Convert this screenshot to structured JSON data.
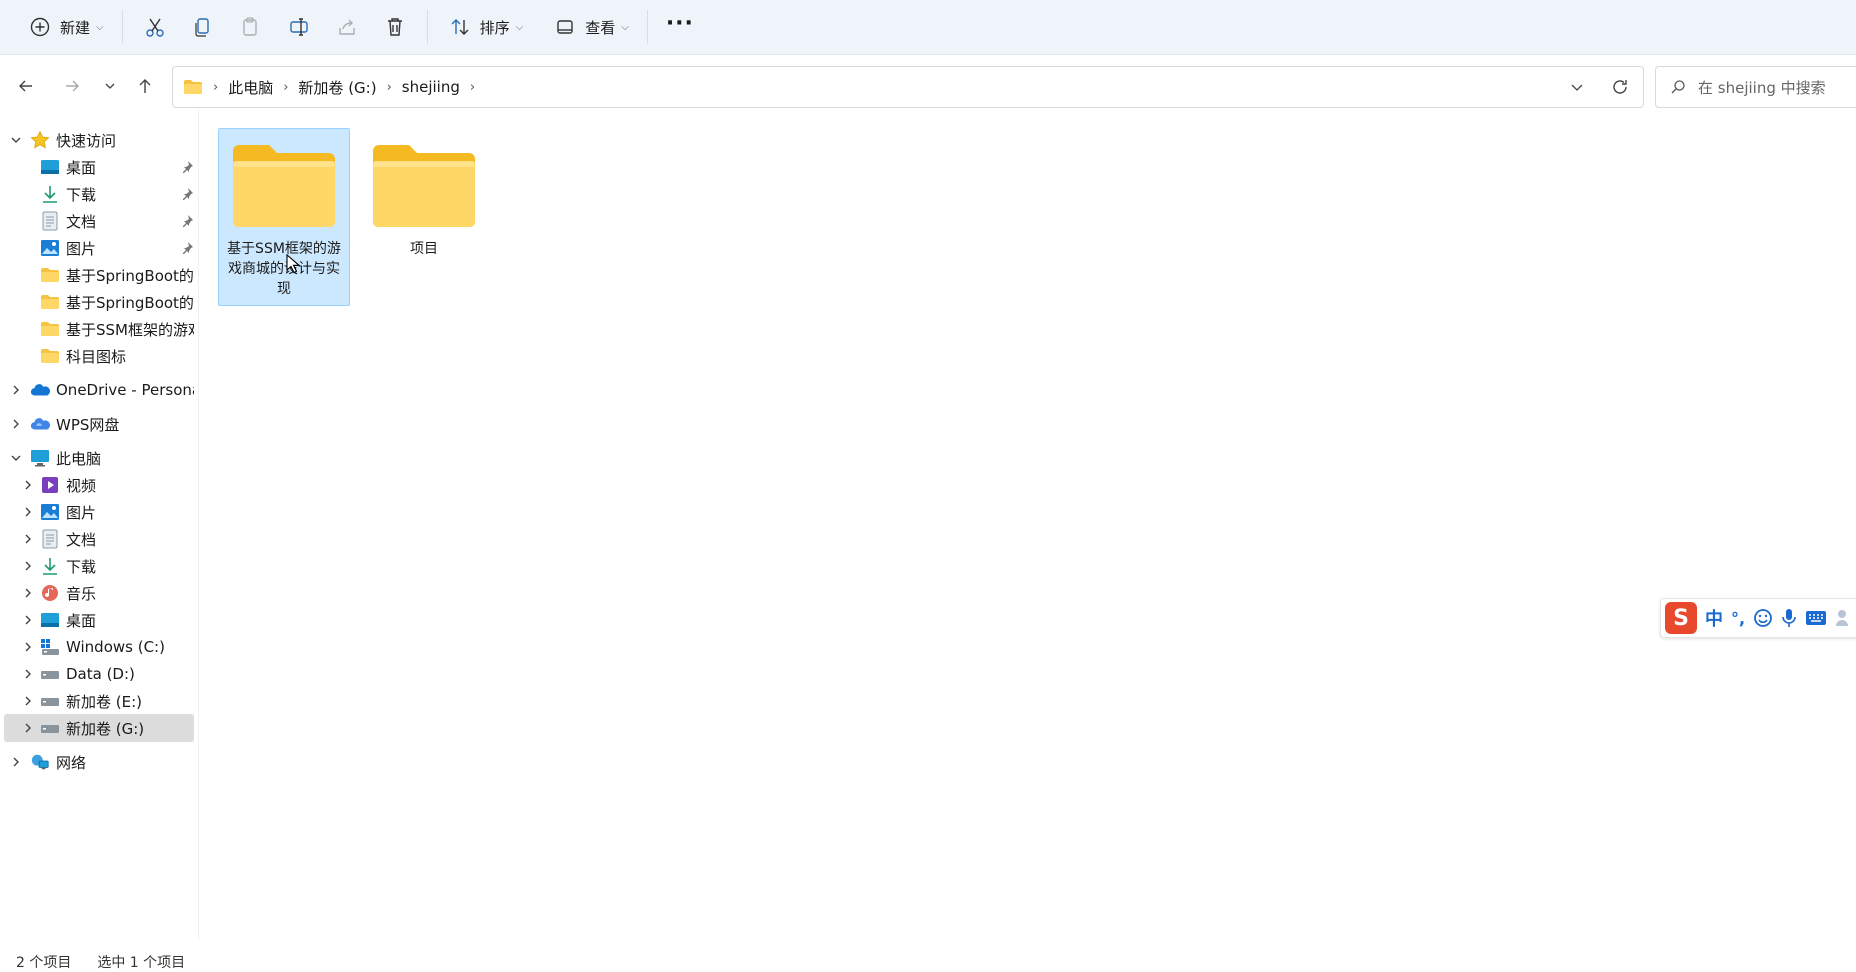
{
  "toolbar": {
    "new_label": "新建",
    "sort_label": "排序",
    "view_label": "查看",
    "more_glyph": "···"
  },
  "address": {
    "crumbs": [
      "此电脑",
      "新加卷 (G:)",
      "shejiing"
    ]
  },
  "search": {
    "placeholder": "在 shejiing 中搜索"
  },
  "sidebar": {
    "quick_access": "快速访问",
    "quick_items": [
      "桌面",
      "下载",
      "文档",
      "图片",
      "基于SpringBoot的",
      "基于SpringBoot的",
      "基于SSM框架的游戏",
      "科目图标"
    ],
    "onedrive": "OneDrive - Persona",
    "wps": "WPS网盘",
    "this_pc": "此电脑",
    "pc_items": [
      "视频",
      "图片",
      "文档",
      "下载",
      "音乐",
      "桌面",
      "Windows (C:)",
      "Data (D:)",
      "新加卷 (E:)",
      "新加卷 (G:)"
    ],
    "network": "网络"
  },
  "content": {
    "folders": [
      {
        "label": "基于SSM框架的游戏商城的设计与实现",
        "selected": true
      },
      {
        "label": "项目",
        "selected": false
      }
    ]
  },
  "status": {
    "count": "2 个项目",
    "selected": "选中 1 个项目"
  },
  "ime": {
    "mode": "中",
    "punct": "°,"
  },
  "colors": {
    "accent": "#0067c0",
    "selection": "#cce8ff",
    "folder": "#ffd766"
  }
}
